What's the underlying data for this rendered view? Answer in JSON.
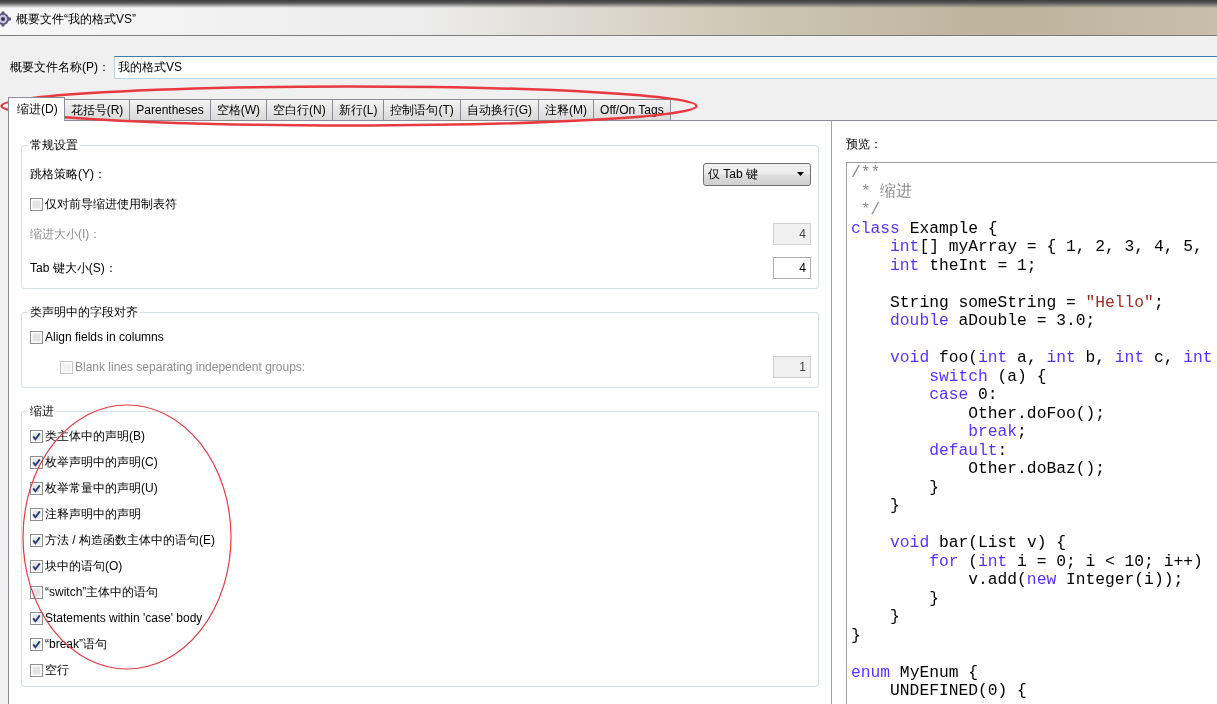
{
  "window": {
    "title": "概要文件“我的格式VS”"
  },
  "profile_name": {
    "label": "概要文件名称(P)：",
    "value": "我的格式VS"
  },
  "tab_bar": {
    "circled": true,
    "tabs": [
      {
        "label": "缩进(D)",
        "selected": true
      },
      {
        "label": "花括号(R)",
        "selected": false
      },
      {
        "label": "Parentheses",
        "selected": false
      },
      {
        "label": "空格(W)",
        "selected": false
      },
      {
        "label": "空白行(N)",
        "selected": false
      },
      {
        "label": "新行(L)",
        "selected": false
      },
      {
        "label": "控制语句(T)",
        "selected": false
      },
      {
        "label": "自动换行(G)",
        "selected": false
      },
      {
        "label": "注释(M)",
        "selected": false
      },
      {
        "label": "Off/On Tags",
        "selected": false
      }
    ]
  },
  "groups": [
    {
      "title": "常规设置",
      "circled": false,
      "rows": [
        {
          "kind": "dropdown",
          "label": "跳格策略(Y)：",
          "value": "仅 Tab 键",
          "disabled": false
        },
        {
          "kind": "checkbox",
          "label": "仅对前导缩进使用制表符",
          "checked": false,
          "disabled": false
        },
        {
          "kind": "number",
          "label": "缩进大小(I)：",
          "value": "4",
          "disabled": true
        },
        {
          "kind": "number",
          "label": "Tab 键大小(S)：",
          "value": "4",
          "disabled": false
        }
      ]
    },
    {
      "title": "类声明中的字段对齐",
      "circled": false,
      "rows": [
        {
          "kind": "checkbox",
          "label": "Align fields in columns",
          "checked": false,
          "disabled": false,
          "children": [
            {
              "kind": "checkbox_number",
              "label": "Blank lines separating independent groups:",
              "checked": false,
              "disabled": true,
              "value": "1"
            }
          ]
        }
      ]
    },
    {
      "title": "缩进",
      "circled": true,
      "rows": [
        {
          "kind": "checkbox",
          "label": "类主体中的声明(B)",
          "checked": true
        },
        {
          "kind": "checkbox",
          "label": "枚举声明中的声明(C)",
          "checked": true
        },
        {
          "kind": "checkbox",
          "label": "枚举常量中的声明(U)",
          "checked": true
        },
        {
          "kind": "checkbox",
          "label": "注释声明中的声明",
          "checked": true
        },
        {
          "kind": "checkbox",
          "label": "方法 / 构造函数主体中的语句(E)",
          "checked": true
        },
        {
          "kind": "checkbox",
          "label": "块中的语句(O)",
          "checked": true
        },
        {
          "kind": "checkbox",
          "label": "“switch”主体中的语句",
          "checked": false
        },
        {
          "kind": "checkbox",
          "label": "Statements within 'case' body",
          "checked": true
        },
        {
          "kind": "checkbox",
          "label": "“break”语句",
          "checked": true
        },
        {
          "kind": "checkbox",
          "label": "空行",
          "checked": false
        }
      ]
    }
  ],
  "preview": {
    "label": "预览：",
    "code_lines": [
      {
        "kind": "code",
        "tokens": [
          {
            "kind": "comment",
            "text": "/**"
          }
        ]
      },
      {
        "kind": "code",
        "tokens": [
          {
            "kind": "comment",
            "text": " * 缩进"
          }
        ]
      },
      {
        "kind": "code",
        "tokens": [
          {
            "kind": "comment",
            "text": " */"
          }
        ]
      },
      {
        "kind": "code",
        "tokens": [
          {
            "kind": "keyword",
            "text": "class"
          },
          {
            "kind": "plain",
            "text": " Example {"
          }
        ]
      },
      {
        "kind": "code",
        "tokens": [
          {
            "kind": "keyword",
            "text": "    int"
          },
          {
            "kind": "plain",
            "text": "[] myArray = { 1, 2, 3, 4, 5,"
          }
        ]
      },
      {
        "kind": "code",
        "tokens": [
          {
            "kind": "keyword",
            "text": "    int"
          },
          {
            "kind": "plain",
            "text": " theInt = 1;"
          }
        ]
      },
      {
        "kind": "blank"
      },
      {
        "kind": "code",
        "tokens": [
          {
            "kind": "plain",
            "text": "    String someString = "
          },
          {
            "kind": "string",
            "text": "\"Hello\""
          },
          {
            "kind": "plain",
            "text": ";"
          }
        ]
      },
      {
        "kind": "code",
        "tokens": [
          {
            "kind": "keyword",
            "text": "    double"
          },
          {
            "kind": "plain",
            "text": " aDouble = 3.0;"
          }
        ]
      },
      {
        "kind": "blank"
      },
      {
        "kind": "code",
        "tokens": [
          {
            "kind": "keyword",
            "text": "    void"
          },
          {
            "kind": "plain",
            "text": " foo("
          },
          {
            "kind": "keyword",
            "text": "int"
          },
          {
            "kind": "plain",
            "text": " a, "
          },
          {
            "kind": "keyword",
            "text": "int"
          },
          {
            "kind": "plain",
            "text": " b, "
          },
          {
            "kind": "keyword",
            "text": "int"
          },
          {
            "kind": "plain",
            "text": " c, "
          },
          {
            "kind": "keyword",
            "text": "int"
          }
        ]
      },
      {
        "kind": "code",
        "tokens": [
          {
            "kind": "keyword",
            "text": "        switch"
          },
          {
            "kind": "plain",
            "text": " (a) {"
          }
        ]
      },
      {
        "kind": "code",
        "tokens": [
          {
            "kind": "keyword",
            "text": "        case"
          },
          {
            "kind": "plain",
            "text": " 0:"
          }
        ]
      },
      {
        "kind": "code",
        "tokens": [
          {
            "kind": "plain",
            "text": "            Other.doFoo();"
          }
        ]
      },
      {
        "kind": "code",
        "tokens": [
          {
            "kind": "keyword",
            "text": "            break"
          },
          {
            "kind": "plain",
            "text": ";"
          }
        ]
      },
      {
        "kind": "code",
        "tokens": [
          {
            "kind": "keyword",
            "text": "        default"
          },
          {
            "kind": "plain",
            "text": ":"
          }
        ]
      },
      {
        "kind": "code",
        "tokens": [
          {
            "kind": "plain",
            "text": "            Other.doBaz();"
          }
        ]
      },
      {
        "kind": "code",
        "tokens": [
          {
            "kind": "plain",
            "text": "        }"
          }
        ]
      },
      {
        "kind": "code",
        "tokens": [
          {
            "kind": "plain",
            "text": "    }"
          }
        ]
      },
      {
        "kind": "blank"
      },
      {
        "kind": "code",
        "tokens": [
          {
            "kind": "keyword",
            "text": "    void"
          },
          {
            "kind": "plain",
            "text": " bar(List v) {"
          }
        ]
      },
      {
        "kind": "code",
        "tokens": [
          {
            "kind": "keyword",
            "text": "        for"
          },
          {
            "kind": "plain",
            "text": " ("
          },
          {
            "kind": "keyword",
            "text": "int"
          },
          {
            "kind": "plain",
            "text": " i = 0; i < 10; i++)"
          }
        ]
      },
      {
        "kind": "code",
        "tokens": [
          {
            "kind": "plain",
            "text": "            v.add("
          },
          {
            "kind": "keyword",
            "text": "new"
          },
          {
            "kind": "plain",
            "text": " Integer(i));"
          }
        ]
      },
      {
        "kind": "code",
        "tokens": [
          {
            "kind": "plain",
            "text": "        }"
          }
        ]
      },
      {
        "kind": "code",
        "tokens": [
          {
            "kind": "plain",
            "text": "    }"
          }
        ]
      },
      {
        "kind": "code",
        "tokens": [
          {
            "kind": "plain",
            "text": "}"
          }
        ]
      },
      {
        "kind": "blank"
      },
      {
        "kind": "code",
        "tokens": [
          {
            "kind": "keyword",
            "text": "enum"
          },
          {
            "kind": "plain",
            "text": " MyEnum {"
          }
        ]
      },
      {
        "kind": "code",
        "tokens": [
          {
            "kind": "plain",
            "text": "    UNDEFINED(0) {"
          }
        ]
      }
    ]
  }
}
